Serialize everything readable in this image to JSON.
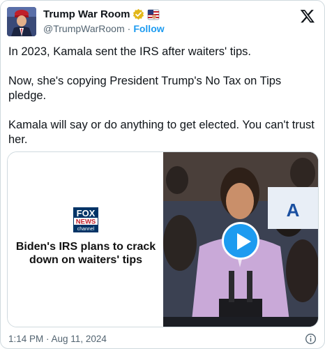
{
  "author": {
    "name": "Trump War Room",
    "handle": "@TrumpWarRoom",
    "separator": "·",
    "follow_label": "Follow"
  },
  "icons": {
    "verified": "verified-badge-icon",
    "flag": "us-flag-emoji-icon",
    "x_logo": "x-logo-icon",
    "play": "play-icon",
    "info": "info-icon"
  },
  "tweet": {
    "paragraphs": [
      "In 2023, Kamala sent the IRS after waiters' tips.",
      "Now, she's copying President Trump's No Tax on Tips pledge.",
      "Kamala will say or do anything to get elected. You can't trust her."
    ]
  },
  "card": {
    "logo": {
      "line1": "FOX",
      "line2": "NEWS",
      "line3": "channel"
    },
    "headline": "Biden's IRS plans to crack down on waiters' tips"
  },
  "footer": {
    "timestamp": "1:14 PM · Aug 11, 2024"
  },
  "colors": {
    "accent": "#1d9bf0",
    "text": "#0f1419",
    "secondary": "#536471",
    "verified_gold": "#e2b719",
    "fox_blue": "#003366"
  }
}
